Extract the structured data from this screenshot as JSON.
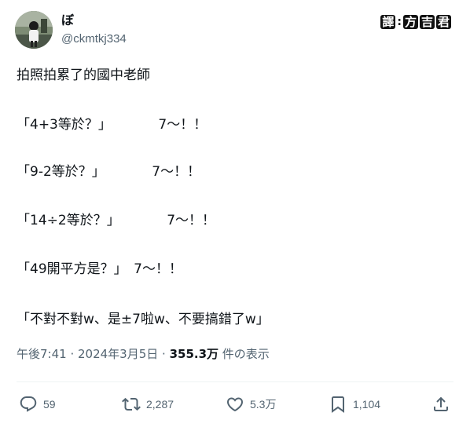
{
  "author": {
    "display_name": "ぼ",
    "handle": "@ckmtkj334"
  },
  "watermark": {
    "label_char": "譯",
    "separator": ":",
    "name_chars": [
      "方",
      "吉",
      "君"
    ]
  },
  "post": {
    "lines": [
      "拍照拍累了的國中老師",
      "「4+3等於？」　　　　7～！！",
      "「9-2等於？」　　　　7～！！",
      "「14÷2等於？」　　　　7～！！",
      "「49開平方是？」　7～！！",
      "「不對不對w、是±7啦w、不要搞錯了w」"
    ]
  },
  "meta": {
    "time": "午後7:41",
    "separator1": " · ",
    "date": "2024年3月5日",
    "separator2": " · ",
    "views_count": "355.3万",
    "views_label": " 件の表示"
  },
  "actions": {
    "replies": "59",
    "reposts": "2,287",
    "likes": "5.3万",
    "bookmarks": "1,104"
  },
  "icons": {
    "reply": "reply-icon",
    "repost": "repost-icon",
    "like": "heart-icon",
    "bookmark": "bookmark-icon",
    "share": "share-icon"
  },
  "colors": {
    "text": "#0f1419",
    "secondary": "#536471",
    "divider": "#eff3f4"
  }
}
